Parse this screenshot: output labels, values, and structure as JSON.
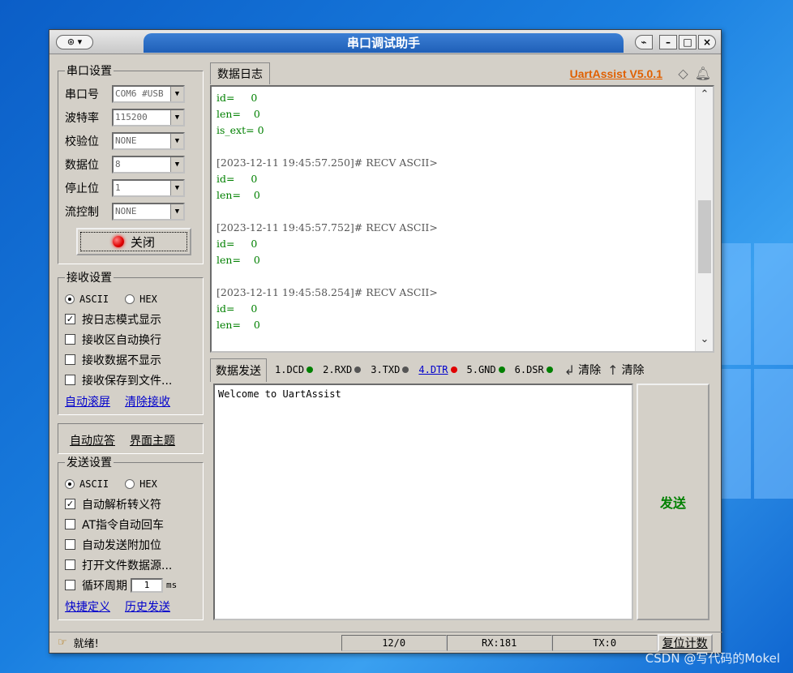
{
  "window": {
    "title": "串口调试助手",
    "sysmenu_glyph": "⊛ ▾",
    "buttons": {
      "pin": "⌁",
      "minimize": "–",
      "maximize": "□",
      "close": "×"
    }
  },
  "serial_settings": {
    "legend": "串口设置",
    "fields": [
      {
        "label": "串口号",
        "value": "COM6 #USB"
      },
      {
        "label": "波特率",
        "value": "115200"
      },
      {
        "label": "校验位",
        "value": "NONE"
      },
      {
        "label": "数据位",
        "value": "8"
      },
      {
        "label": "停止位",
        "value": "1"
      },
      {
        "label": "流控制",
        "value": "NONE"
      }
    ],
    "close_button": "关闭"
  },
  "receive_settings": {
    "legend": "接收设置",
    "radio_ascii": "ASCII",
    "radio_hex": "HEX",
    "options": [
      {
        "label": "按日志模式显示",
        "checked": true
      },
      {
        "label": "接收区自动换行",
        "checked": false
      },
      {
        "label": "接收数据不显示",
        "checked": false
      },
      {
        "label": "接收保存到文件...",
        "checked": false
      }
    ],
    "link_autoscroll": "自动滚屏",
    "link_clear": "清除接收"
  },
  "extra_links": {
    "auto_reply": "自动应答",
    "theme": "界面主题"
  },
  "send_settings": {
    "legend": "发送设置",
    "radio_ascii": "ASCII",
    "radio_hex": "HEX",
    "options": [
      {
        "label": "自动解析转义符",
        "checked": true
      },
      {
        "label": "AT指令自动回车",
        "checked": false
      },
      {
        "label": "自动发送附加位",
        "checked": false
      },
      {
        "label": "打开文件数据源...",
        "checked": false
      }
    ],
    "cycle_label": "循环周期",
    "cycle_value": "1",
    "cycle_unit": "ms",
    "link_shortcuts": "快捷定义",
    "link_history": "历史发送"
  },
  "log_panel": {
    "tab": "数据日志",
    "brand": "UartAssist V5.0.1",
    "lines": [
      {
        "t": "id=     0",
        "c": "g"
      },
      {
        "t": "len=    0",
        "c": "g"
      },
      {
        "t": "is_ext= 0",
        "c": "g"
      },
      {
        "t": "",
        "c": "g"
      },
      {
        "t": "[2023-12-11 19:45:57.250]# RECV ASCII>",
        "c": "h"
      },
      {
        "t": "id=     0",
        "c": "g"
      },
      {
        "t": "len=    0",
        "c": "g"
      },
      {
        "t": "",
        "c": "g"
      },
      {
        "t": "[2023-12-11 19:45:57.752]# RECV ASCII>",
        "c": "h"
      },
      {
        "t": "id=     0",
        "c": "g"
      },
      {
        "t": "len=    0",
        "c": "g"
      },
      {
        "t": "",
        "c": "g"
      },
      {
        "t": "[2023-12-11 19:45:58.254]# RECV ASCII>",
        "c": "h"
      },
      {
        "t": "id=     0",
        "c": "g"
      },
      {
        "t": "len=    0",
        "c": "g"
      }
    ]
  },
  "send_panel": {
    "tab": "数据发送",
    "pins": [
      {
        "label": "1.DCD",
        "color": "#008000"
      },
      {
        "label": "2.RXD",
        "color": "#555555"
      },
      {
        "label": "3.TXD",
        "color": "#555555"
      },
      {
        "label": "4.DTR",
        "color": "#e00000"
      },
      {
        "label": "5.GND",
        "color": "#008000"
      },
      {
        "label": "6.DSR",
        "color": "#008000"
      }
    ],
    "clear_rx": "清除",
    "clear_tx": "清除",
    "text": "Welcome to UartAssist",
    "send_button": "发送"
  },
  "status": {
    "ready": "就绪!",
    "counter": "12/0",
    "rx": "RX:181",
    "tx": "TX:0",
    "reset": "复位计数"
  },
  "watermark": "CSDN @写代码的Mokel"
}
